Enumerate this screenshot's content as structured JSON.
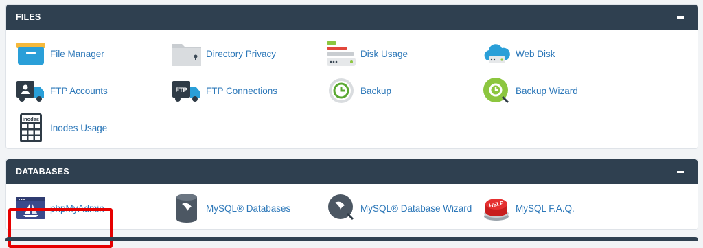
{
  "sections": {
    "files": {
      "title": "FILES",
      "items": [
        {
          "label": "File Manager",
          "icon": "file-manager-icon"
        },
        {
          "label": "Directory Privacy",
          "icon": "folder-lock-icon"
        },
        {
          "label": "Disk Usage",
          "icon": "disk-usage-icon"
        },
        {
          "label": "Web Disk",
          "icon": "cloud-drive-icon"
        },
        {
          "label": "FTP Accounts",
          "icon": "ftp-accounts-truck-icon"
        },
        {
          "label": "FTP Connections",
          "icon": "ftp-connections-truck-icon"
        },
        {
          "label": "Backup",
          "icon": "backup-clock-icon"
        },
        {
          "label": "Backup Wizard",
          "icon": "backup-wizard-icon"
        },
        {
          "label": "Inodes Usage",
          "icon": "inodes-calculator-icon"
        }
      ]
    },
    "databases": {
      "title": "DATABASES",
      "items": [
        {
          "label": "phpMyAdmin",
          "icon": "phpmyadmin-sailboat-icon"
        },
        {
          "label": "MySQL® Databases",
          "icon": "mysql-database-cylinder-icon"
        },
        {
          "label": "MySQL® Database Wizard",
          "icon": "mysql-wizard-icon"
        },
        {
          "label": "MySQL F.A.Q.",
          "icon": "help-button-icon"
        }
      ]
    }
  },
  "icon_texts": {
    "ftp": "FTP",
    "inodes": "inodes",
    "help": "HELP"
  },
  "colors": {
    "header_bg": "#2f4050",
    "link": "#2d78b9",
    "highlight": "#e60000"
  }
}
